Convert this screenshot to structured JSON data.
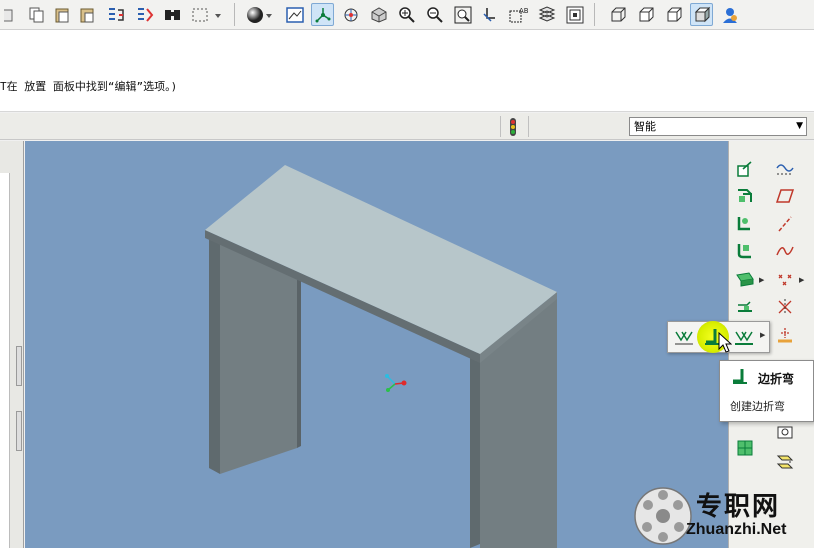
{
  "toolbar": {
    "icons": [
      "copy-icon",
      "paste-icon",
      "paste-special-icon",
      "regenerate-icon",
      "regenerate-manager-icon",
      "find-icon",
      "select-box-icon",
      "display-style-icon",
      "saved-views-icon",
      "datum-display-icon",
      "spin-center-icon",
      "refit-icon",
      "zoom-in-icon",
      "zoom-out-icon",
      "refit-view-icon",
      "orient-icon",
      "annotation-icon",
      "layers-icon",
      "model-tree-icon",
      "wireframe-icon",
      "hidden-line-icon",
      "no-hidden-icon",
      "shading-icon",
      "user-icon"
    ]
  },
  "message": {
    "text": "T在 放置 面板中找到“编辑”选项。)"
  },
  "filter": {
    "selected": "智能"
  },
  "right_toolbar": {
    "icons": [
      "extend-icon",
      "sketch-datum-icon",
      "flat-wall-icon",
      "datum-plane-icon",
      "flange-wall-icon",
      "datum-axis-icon",
      "unbend-icon",
      "datum-curve-icon",
      "bend-back-icon",
      "datum-point-icon",
      "punch-icon",
      "coordinate-system-icon",
      "form-icon",
      "analysis-icon",
      "corner-relief-icon",
      "rip-icon",
      "merge-icon",
      "flatten-icon"
    ]
  },
  "flyout": {
    "items": [
      "flat-wall-icon",
      "flange-wall-icon",
      "unattached-wall-icon"
    ]
  },
  "tooltip": {
    "title": "边折弯",
    "description": "创建边折弯"
  },
  "watermark": {
    "cn": "专职网",
    "en": "Zhuanzhi.Net"
  },
  "colors": {
    "viewport_bg": "#7a9bc0",
    "model_top": "#b7c6ca",
    "model_side": "#6f7a7e",
    "highlight": "#e4f600"
  }
}
